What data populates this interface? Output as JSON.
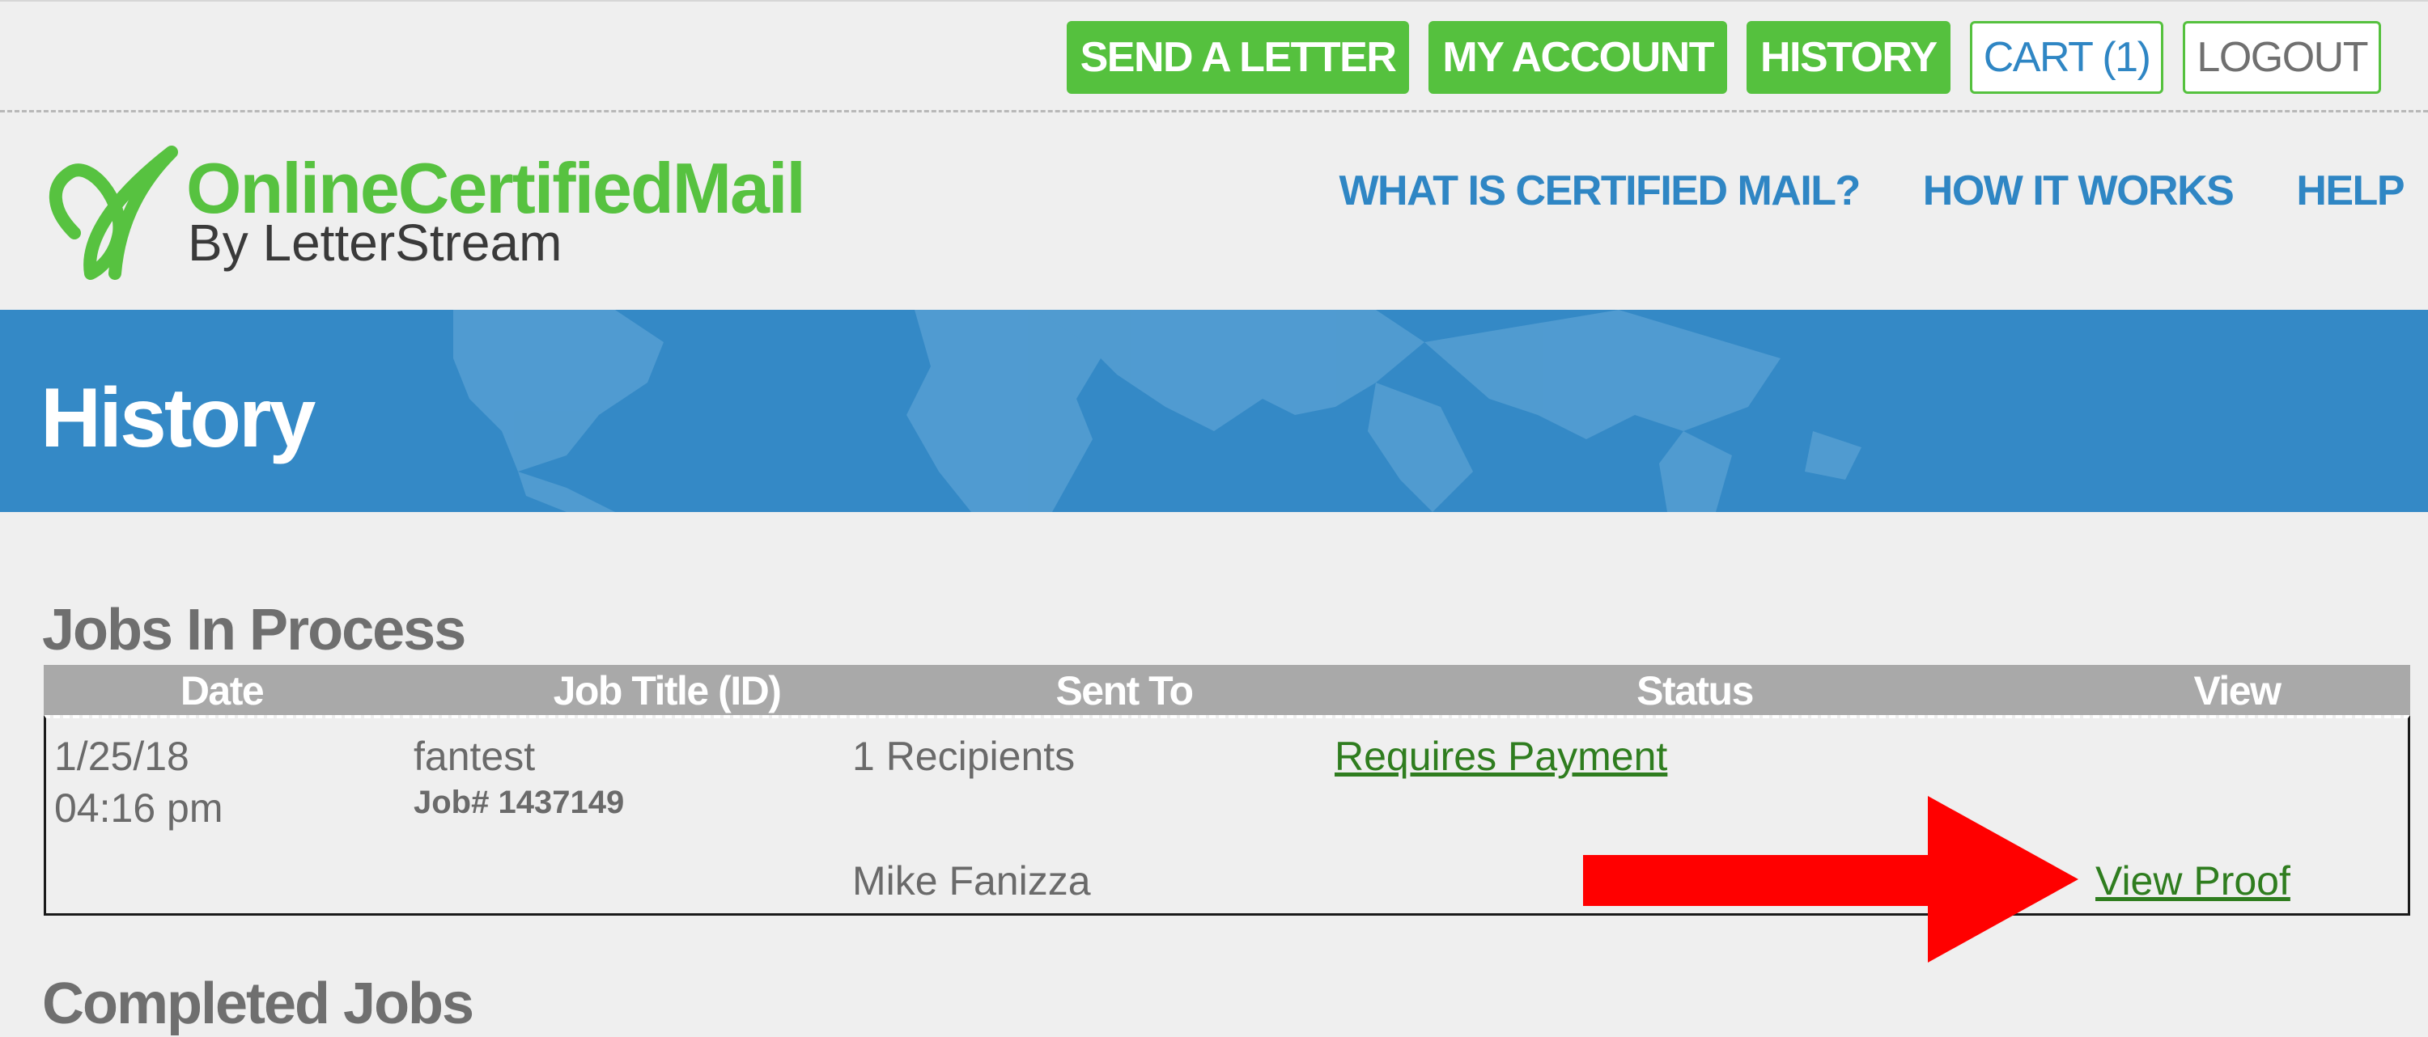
{
  "topnav": {
    "send_letter": "SEND A LETTER",
    "my_account": "MY ACCOUNT",
    "history": "HISTORY",
    "cart": "CART (1)",
    "logout": "LOGOUT"
  },
  "logo": {
    "brand": "OnlineCertifiedMail",
    "byline": "By LetterStream"
  },
  "mainnav": {
    "what_is": "WHAT IS CERTIFIED MAIL?",
    "how_it_works": "HOW IT WORKS",
    "help": "HELP"
  },
  "banner": {
    "title": "History"
  },
  "jobs_in_process": {
    "title": "Jobs In Process",
    "columns": [
      "Date",
      "Job Title (ID)",
      "Sent To",
      "Status",
      "View"
    ],
    "row": {
      "date": "1/25/18",
      "time": "04:16 pm",
      "job_title": "fantest",
      "job_id": "Job# 1437149",
      "sent_to_count": "1 Recipients",
      "recipient": "Mike Fanizza",
      "status": "Requires Payment",
      "view": "View Proof"
    }
  },
  "completed_jobs": {
    "title": "Completed Jobs"
  },
  "colors": {
    "green": "#55c13e",
    "blue": "#3489c6",
    "link_green": "#2f7d1f",
    "arrow_red": "#ff0000"
  }
}
